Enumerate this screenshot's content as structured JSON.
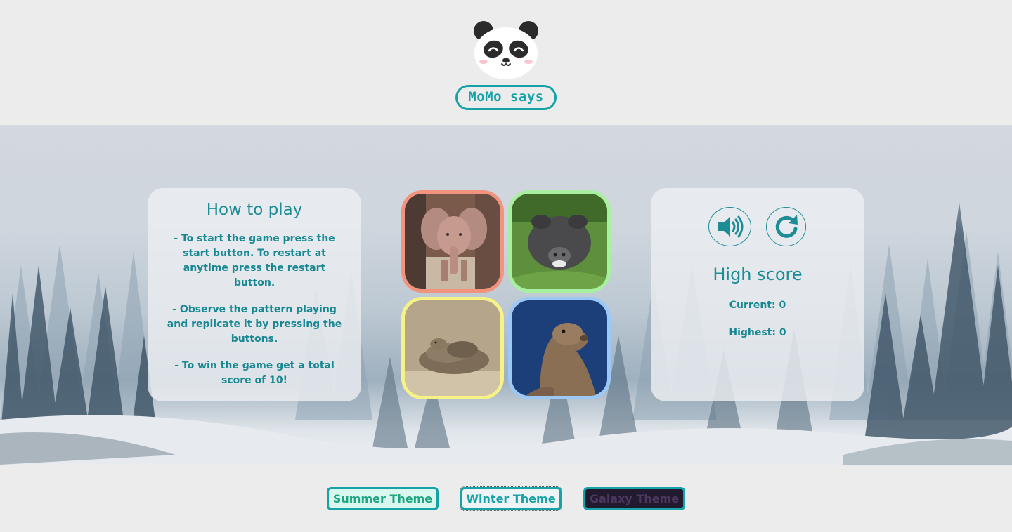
{
  "header": {
    "logo_icon": "panda-face-icon",
    "title": "MoMo says"
  },
  "instructions": {
    "title": "How to play",
    "items": [
      "- To start the game press the start button. To restart at anytime press the restart button.",
      "- Observe the pattern playing and replicate it by pressing the buttons.",
      "- To win the game get a total score of 10!"
    ]
  },
  "game_board": {
    "tiles": [
      {
        "animal": "elephant",
        "border_color": "#f2937e"
      },
      {
        "animal": "pig",
        "border_color": "#a8f0a0"
      },
      {
        "animal": "rattlesnake",
        "border_color": "#f7f286"
      },
      {
        "animal": "sea-lion",
        "border_color": "#9cc8f6"
      }
    ]
  },
  "score_panel": {
    "sound_icon": "speaker-volume-icon",
    "restart_icon": "restart-arrow-icon",
    "title": "High score",
    "current": "Current: 0",
    "highest": "Highest: 0"
  },
  "themes": {
    "summer": "Summer Theme",
    "winter": "Winter Theme",
    "galaxy": "Galaxy Theme"
  },
  "colors": {
    "accent": "#17a2a8",
    "text": "#178891",
    "background": "#ececec"
  }
}
